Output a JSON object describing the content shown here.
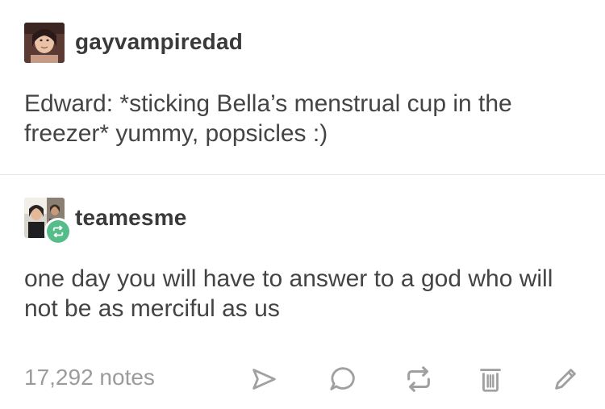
{
  "posts": [
    {
      "username": "gayvampiredad",
      "avatar_icon": "avatar-photo-icon",
      "text": "Edward: *sticking Bella’s menstrual cup in the freezer* yummy, popsicles :)"
    },
    {
      "username": "teamesme",
      "avatar_icon": "avatar-photo-icon",
      "badge_icon": "reblog-badge-icon",
      "text": "one day you will have to answer to a god who will not be as merciful as us"
    }
  ],
  "footer": {
    "notes": "17,292 notes",
    "actions": [
      {
        "icon": "share-icon"
      },
      {
        "icon": "reply-icon"
      },
      {
        "icon": "reblog-icon"
      },
      {
        "icon": "delete-icon"
      },
      {
        "icon": "edit-icon"
      }
    ]
  },
  "colors": {
    "text": "#444444",
    "username": "#3a3a3a",
    "muted": "#9b9b9b",
    "reblog_badge": "#56bc8a",
    "divider": "#e6e6e6"
  }
}
